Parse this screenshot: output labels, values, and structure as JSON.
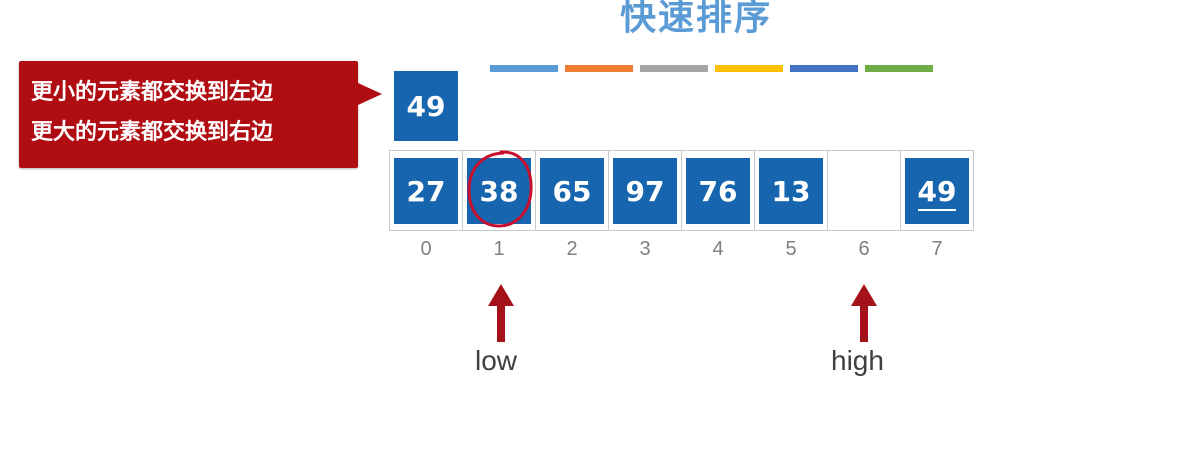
{
  "title": "快速排序",
  "color_bars": [
    "#5b9bd5",
    "#ed7d31",
    "#a5a5a5",
    "#ffc000",
    "#4472c4",
    "#70ad47"
  ],
  "callout": {
    "line1": "更小的元素都交换到左边",
    "line2": "更大的元素都交换到右边"
  },
  "pivot": "49",
  "array": [
    {
      "index": "0",
      "value": "27"
    },
    {
      "index": "1",
      "value": "38"
    },
    {
      "index": "2",
      "value": "65"
    },
    {
      "index": "3",
      "value": "97"
    },
    {
      "index": "4",
      "value": "76"
    },
    {
      "index": "5",
      "value": "13"
    },
    {
      "index": "6",
      "value": ""
    },
    {
      "index": "7",
      "value": "49"
    }
  ],
  "low_label": "low",
  "high_label": "high",
  "colors": {
    "cell": "#1665ae",
    "callout": "#b00d12",
    "arrow": "#a5121a",
    "title": "#5b9bd5",
    "circle": "#c8102e"
  }
}
